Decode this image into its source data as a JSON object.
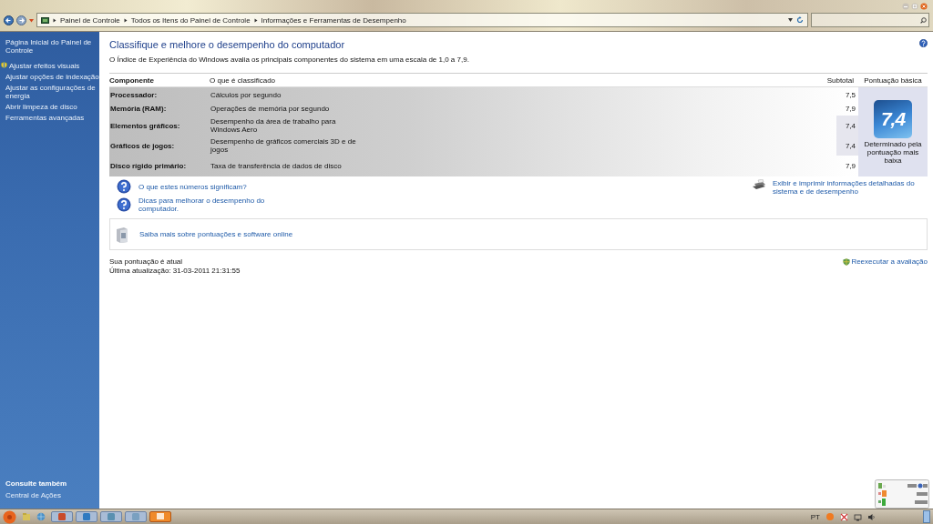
{
  "address_bar": {
    "breadcrumbs": [
      "Painel de Controle",
      "Todos os Itens do Painel de Controle",
      "Informações e Ferramentas de Desempenho"
    ]
  },
  "sidebar": {
    "items": [
      {
        "label": "Página Inicial do Painel de Controle",
        "kind": "home"
      },
      {
        "label": "Ajustar efeitos visuais",
        "kind": "shield"
      },
      {
        "label": "Ajustar opções de indexação",
        "kind": "link"
      },
      {
        "label": "Ajustar as configurações de energia",
        "kind": "link"
      },
      {
        "label": "Abrir limpeza de disco",
        "kind": "link"
      },
      {
        "label": "Ferramentas avançadas",
        "kind": "link"
      }
    ],
    "see_also": {
      "title": "Consulte também",
      "items": [
        "Central de Ações"
      ]
    }
  },
  "content": {
    "title": "Classifique e melhore o desempenho do computador",
    "intro": "O Índice de Experiência do Windows avalia os principais componentes do sistema em uma escala de 1,0 a 7,9.",
    "table": {
      "columns": [
        "Componente",
        "O que é classificado",
        "Subtotal",
        "Pontuação básica"
      ],
      "rows": [
        {
          "component": "Processador:",
          "rated": "Cálculos por segundo",
          "subtotal": "7,5",
          "lowest": false
        },
        {
          "component": "Memória (RAM):",
          "rated": "Operações de memória por segundo",
          "subtotal": "7,9",
          "lowest": false
        },
        {
          "component": "Elementos gráficos:",
          "rated": "Desempenho da área de trabalho para Windows Aero",
          "subtotal": "7,4",
          "lowest": true
        },
        {
          "component": "Gráficos de jogos:",
          "rated": "Desempenho de gráficos comerciais 3D e de jogos",
          "subtotal": "7,4",
          "lowest": true
        },
        {
          "component": "Disco rígido primário:",
          "rated": "Taxa de transferência de dados de disco",
          "subtotal": "7,9",
          "lowest": false
        }
      ]
    },
    "base_score": {
      "value": "7,4",
      "caption": "Determinado pela pontuação mais baixa"
    },
    "help_links": [
      "O que estes números significam?",
      "Dicas para melhorar o desempenho do computador."
    ],
    "print_link": "Exibir e imprimir informações detalhadas do sistema e de desempenho",
    "info_link": "Saiba mais sobre pontuações e software online",
    "status": "Sua pontuação é atual",
    "last_update": "Última atualização: 31-03-2011 21:31:55",
    "rerun_link": "Reexecutar a avaliação"
  },
  "taskbar": {
    "language": "PT"
  }
}
